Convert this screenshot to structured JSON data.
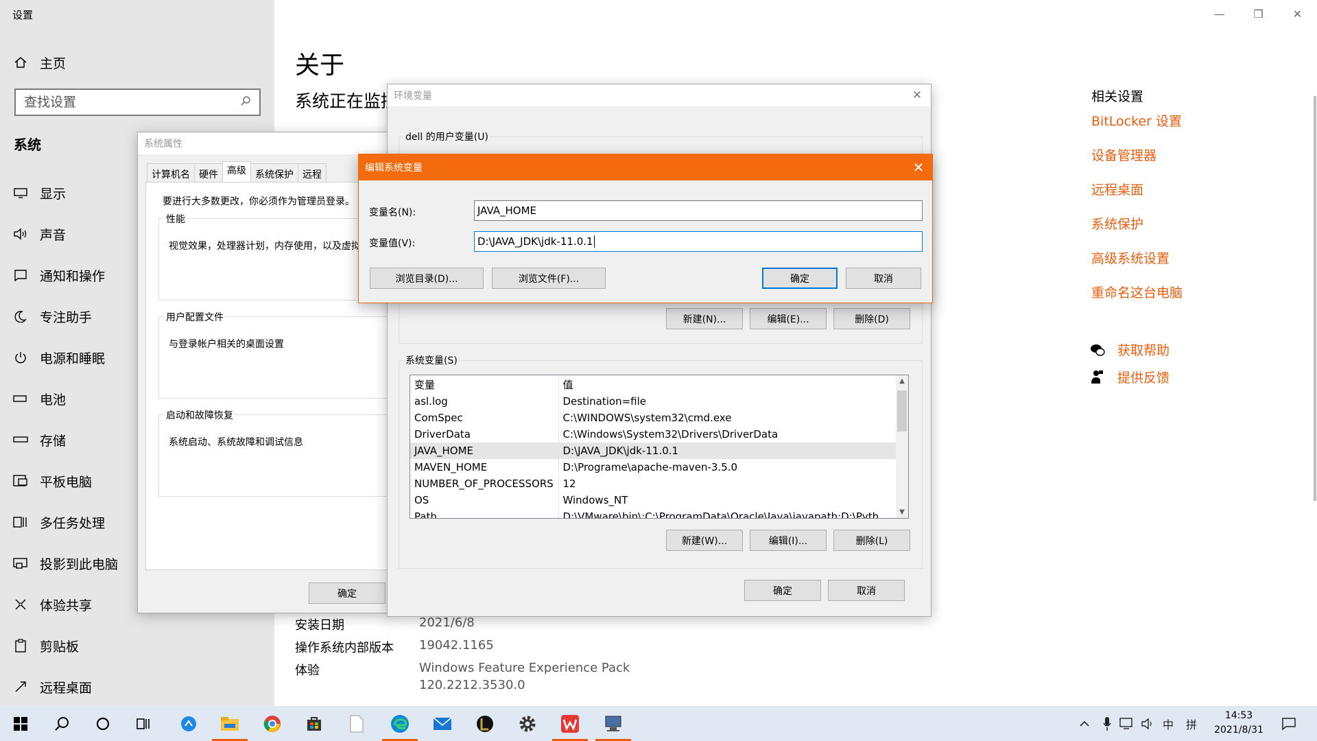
{
  "settings": {
    "window_title": "设置",
    "home_label": "主页",
    "search_placeholder": "查找设置",
    "section": "系统",
    "nav": [
      {
        "label": "显示",
        "icon": "monitor-icon"
      },
      {
        "label": "声音",
        "icon": "speaker-icon"
      },
      {
        "label": "通知和操作",
        "icon": "notification-icon"
      },
      {
        "label": "专注助手",
        "icon": "moon-icon"
      },
      {
        "label": "电源和睡眠",
        "icon": "power-icon"
      },
      {
        "label": "电池",
        "icon": "battery-icon"
      },
      {
        "label": "存储",
        "icon": "storage-icon"
      },
      {
        "label": "平板电脑",
        "icon": "tablet-icon"
      },
      {
        "label": "多任务处理",
        "icon": "multitask-icon"
      },
      {
        "label": "投影到此电脑",
        "icon": "project-icon"
      },
      {
        "label": "体验共享",
        "icon": "share-icon"
      },
      {
        "label": "剪贴板",
        "icon": "clipboard-icon"
      },
      {
        "label": "远程桌面",
        "icon": "remote-icon"
      }
    ],
    "page_title": "关于",
    "page_subtitle": "系统正在监控并保护你的电脑。",
    "specs": [
      {
        "label": "安装日期",
        "value": "2021/6/8"
      },
      {
        "label": "操作系统内部版本",
        "value": "19042.1165"
      },
      {
        "label": "体验",
        "value": "Windows Feature Experience Pack"
      }
    ],
    "experience_version": "120.2212.3530.0",
    "related_title": "相关设置",
    "related_links": [
      "BitLocker 设置",
      "设备管理器",
      "远程桌面",
      "系统保护",
      "高级系统设置",
      "重命名这台电脑"
    ],
    "help_links": [
      "获取帮助",
      "提供反馈"
    ],
    "accent_color": "#e85d0c"
  },
  "sysprop": {
    "title": "系统属性",
    "tabs": [
      "计算机名",
      "硬件",
      "高级",
      "系统保护",
      "远程"
    ],
    "active_tab": "高级",
    "admin_note": "要进行大多数更改，你必须作为管理员登录。",
    "perf_label": "性能",
    "perf_desc": "视觉效果，处理器计划，内存使用，以及虚拟内存",
    "profile_label": "用户配置文件",
    "profile_desc": "与登录帐户相关的桌面设置",
    "startup_label": "启动和故障恢复",
    "startup_desc": "系统启动、系统故障和调试信息",
    "ok": "确定"
  },
  "envvar": {
    "title": "环境变量",
    "user_vars_label": "dell 的用户变量(U)",
    "user_buttons": {
      "new": "新建(N)...",
      "edit": "编辑(E)...",
      "delete": "删除(D)"
    },
    "sys_vars_label": "系统变量(S)",
    "columns": [
      "变量",
      "值"
    ],
    "rows": [
      {
        "name": "asl.log",
        "value": "Destination=file"
      },
      {
        "name": "ComSpec",
        "value": "C:\\WINDOWS\\system32\\cmd.exe"
      },
      {
        "name": "DriverData",
        "value": "C:\\Windows\\System32\\Drivers\\DriverData"
      },
      {
        "name": "JAVA_HOME",
        "value": "D:\\JAVA_JDK\\jdk-11.0.1"
      },
      {
        "name": "MAVEN_HOME",
        "value": "D:\\Programe\\apache-maven-3.5.0"
      },
      {
        "name": "NUMBER_OF_PROCESSORS",
        "value": "12"
      },
      {
        "name": "OS",
        "value": "Windows_NT"
      },
      {
        "name": "Path",
        "value": "D:\\VMware\\bin\\;C:\\ProgramData\\Oracle\\Java\\javapath;D:\\Pyth"
      }
    ],
    "selected_row": "JAVA_HOME",
    "sys_buttons": {
      "new": "新建(W)...",
      "edit": "编辑(I)...",
      "delete": "删除(L)"
    },
    "ok": "确定",
    "cancel": "取消"
  },
  "edit": {
    "title": "编辑系统变量",
    "name_label": "变量名(N):",
    "name_value": "JAVA_HOME",
    "value_label": "变量值(V):",
    "value_value": "D:\\JAVA_JDK\\jdk-11.0.1",
    "browse_dir": "浏览目录(D)...",
    "browse_file": "浏览文件(F)...",
    "ok": "确定",
    "cancel": "取消",
    "title_color": "#f46b0d"
  },
  "taskbar": {
    "apps": [
      "start-icon",
      "search-icon",
      "cortana-icon",
      "task-view-icon",
      "app-blue-icon",
      "file-explorer-icon",
      "chrome-icon",
      "store-icon",
      "notepad-icon",
      "edge-icon",
      "mail-icon",
      "game-icon",
      "settings-icon",
      "wps-icon",
      "sysprop-app-icon"
    ],
    "tray_ime": "中",
    "tray_ime2": "拼",
    "time": "14:53",
    "date": "2021/8/31"
  }
}
